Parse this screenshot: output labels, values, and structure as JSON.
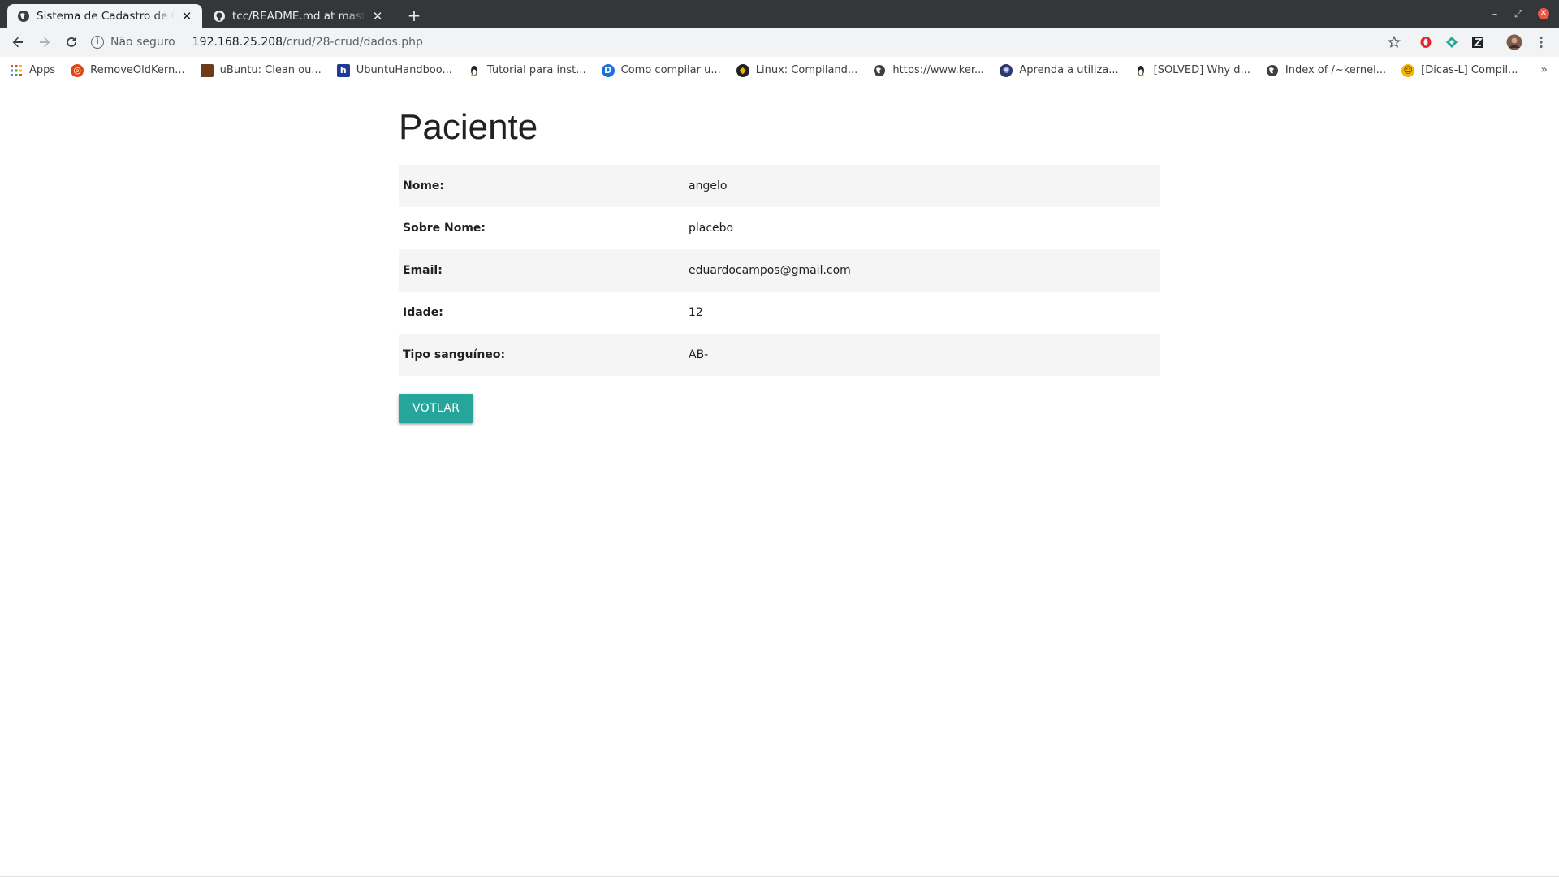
{
  "browser": {
    "tabs": [
      {
        "title": "Sistema de Cadastro de Clientes",
        "active": true,
        "favicon": "globe-icon"
      },
      {
        "title": "tcc/README.md at master · su",
        "active": false,
        "favicon": "github-icon"
      }
    ],
    "new_tab_label": "+",
    "window_controls": {
      "minimize": "–",
      "restore": "⤢",
      "close": "✕"
    },
    "address_bar": {
      "security_label": "Não seguro",
      "url_host": "192.168.25.208",
      "url_path": "/crud/28-crud/dados.php"
    },
    "bookmarks": [
      {
        "label": "Apps",
        "icon": "apps-grid-icon"
      },
      {
        "label": "RemoveOldKern...",
        "icon": "ubuntu-icon"
      },
      {
        "label": "uBuntu: Clean ou...",
        "icon": "site-icon"
      },
      {
        "label": "UbuntuHandboo...",
        "icon": "h-icon"
      },
      {
        "label": "Tutorial para inst...",
        "icon": "linux-icon"
      },
      {
        "label": "Como compilar u...",
        "icon": "d-icon"
      },
      {
        "label": "Linux: Compiland...",
        "icon": "site-icon"
      },
      {
        "label": "https://www.ker...",
        "icon": "globe-icon"
      },
      {
        "label": "Aprenda a utiliza...",
        "icon": "site-icon"
      },
      {
        "label": "[SOLVED] Why d...",
        "icon": "linux-icon"
      },
      {
        "label": "Index of /~kernel...",
        "icon": "globe-icon"
      },
      {
        "label": "[Dicas-L] Compil...",
        "icon": "smiley-icon"
      }
    ],
    "bookmarks_more": "»"
  },
  "page": {
    "title": "Paciente",
    "fields": [
      {
        "label": "Nome:",
        "value": "angelo"
      },
      {
        "label": "Sobre Nome:",
        "value": "placebo"
      },
      {
        "label": "Email:",
        "value": "eduardocampos@gmail.com"
      },
      {
        "label": "Idade:",
        "value": "12"
      },
      {
        "label": "Tipo sanguíneo:",
        "value": "AB-"
      }
    ],
    "back_button_label": "VOTLAR"
  },
  "colors": {
    "button": "#26a69a",
    "stripe": "#f5f5f5",
    "titlebar": "#35363a",
    "toolbar": "#f1f3f4"
  }
}
